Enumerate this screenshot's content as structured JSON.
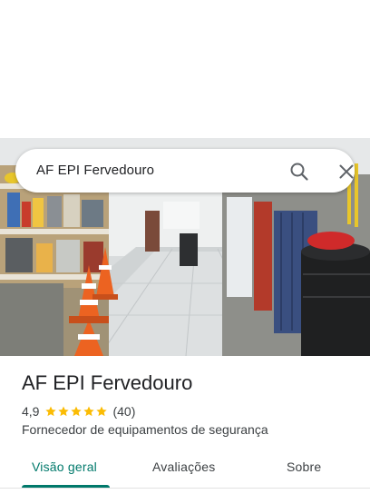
{
  "search": {
    "query": "AF EPI Fervedouro",
    "search_icon": "search-icon",
    "close_icon": "close-icon"
  },
  "photo": {
    "subject": "store-interior-photo"
  },
  "place": {
    "name": "AF EPI Fervedouro",
    "rating": "4,9",
    "stars": 5,
    "review_count": "(40)",
    "category": "Fornecedor de equipamentos de segurança"
  },
  "tabs": [
    {
      "label": "Visão geral",
      "active": true
    },
    {
      "label": "Avaliações",
      "active": false
    },
    {
      "label": "Sobre",
      "active": false
    }
  ],
  "colors": {
    "accent": "#00796b",
    "star": "#fbbc04",
    "text_primary": "#202124",
    "text_secondary": "#3c4043"
  }
}
